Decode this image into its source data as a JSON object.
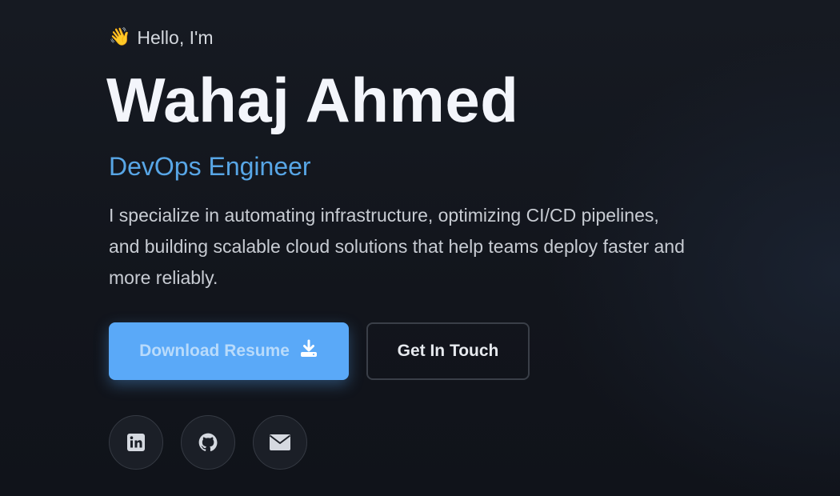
{
  "hero": {
    "greeting_icon": "waving-hand-emoji",
    "greeting_emoji": "👋",
    "greeting": "Hello, I'm",
    "name": "Wahaj Ahmed",
    "role": "DevOps Engineer",
    "description": "I specialize in automating infrastructure, optimizing CI/CD pipelines, and building scalable cloud solutions that help teams deploy faster and more reliably."
  },
  "actions": {
    "download_label": "Download Resume",
    "download_icon": "download-icon",
    "contact_label": "Get In Touch"
  },
  "socials": [
    {
      "icon": "linkedin-icon"
    },
    {
      "icon": "github-icon"
    },
    {
      "icon": "email-icon"
    }
  ],
  "colors": {
    "background": "#12151c",
    "accent": "#5aa9f8",
    "role_text": "#58a6e6",
    "name_text": "#f3f5fb"
  }
}
